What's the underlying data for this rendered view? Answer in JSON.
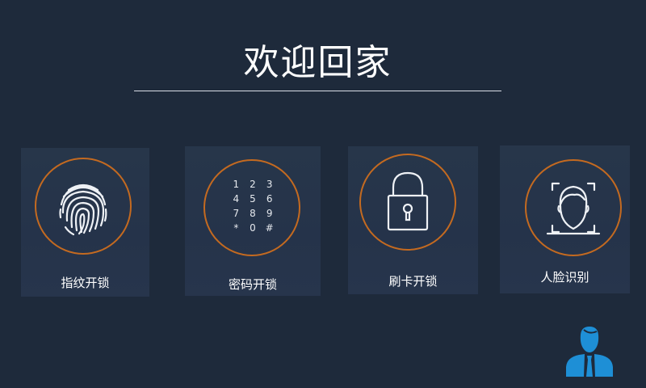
{
  "header": {
    "title": "欢迎回家"
  },
  "unlock_options": [
    {
      "label": "指纹开锁",
      "icon": "fingerprint-icon"
    },
    {
      "label": "密码开锁",
      "icon": "keypad-icon",
      "keys": [
        "1",
        "2",
        "3",
        "4",
        "5",
        "6",
        "7",
        "8",
        "9",
        "*",
        "0",
        "#"
      ]
    },
    {
      "label": "刷卡开锁",
      "icon": "padlock-icon"
    },
    {
      "label": "人脸识别",
      "icon": "face-scan-icon"
    }
  ],
  "user_button": {
    "icon": "user-icon"
  },
  "colors": {
    "background": "#1e2a3b",
    "card": "#26344a",
    "ring": "#c46a20",
    "accent_user": "#1e8fd6"
  }
}
